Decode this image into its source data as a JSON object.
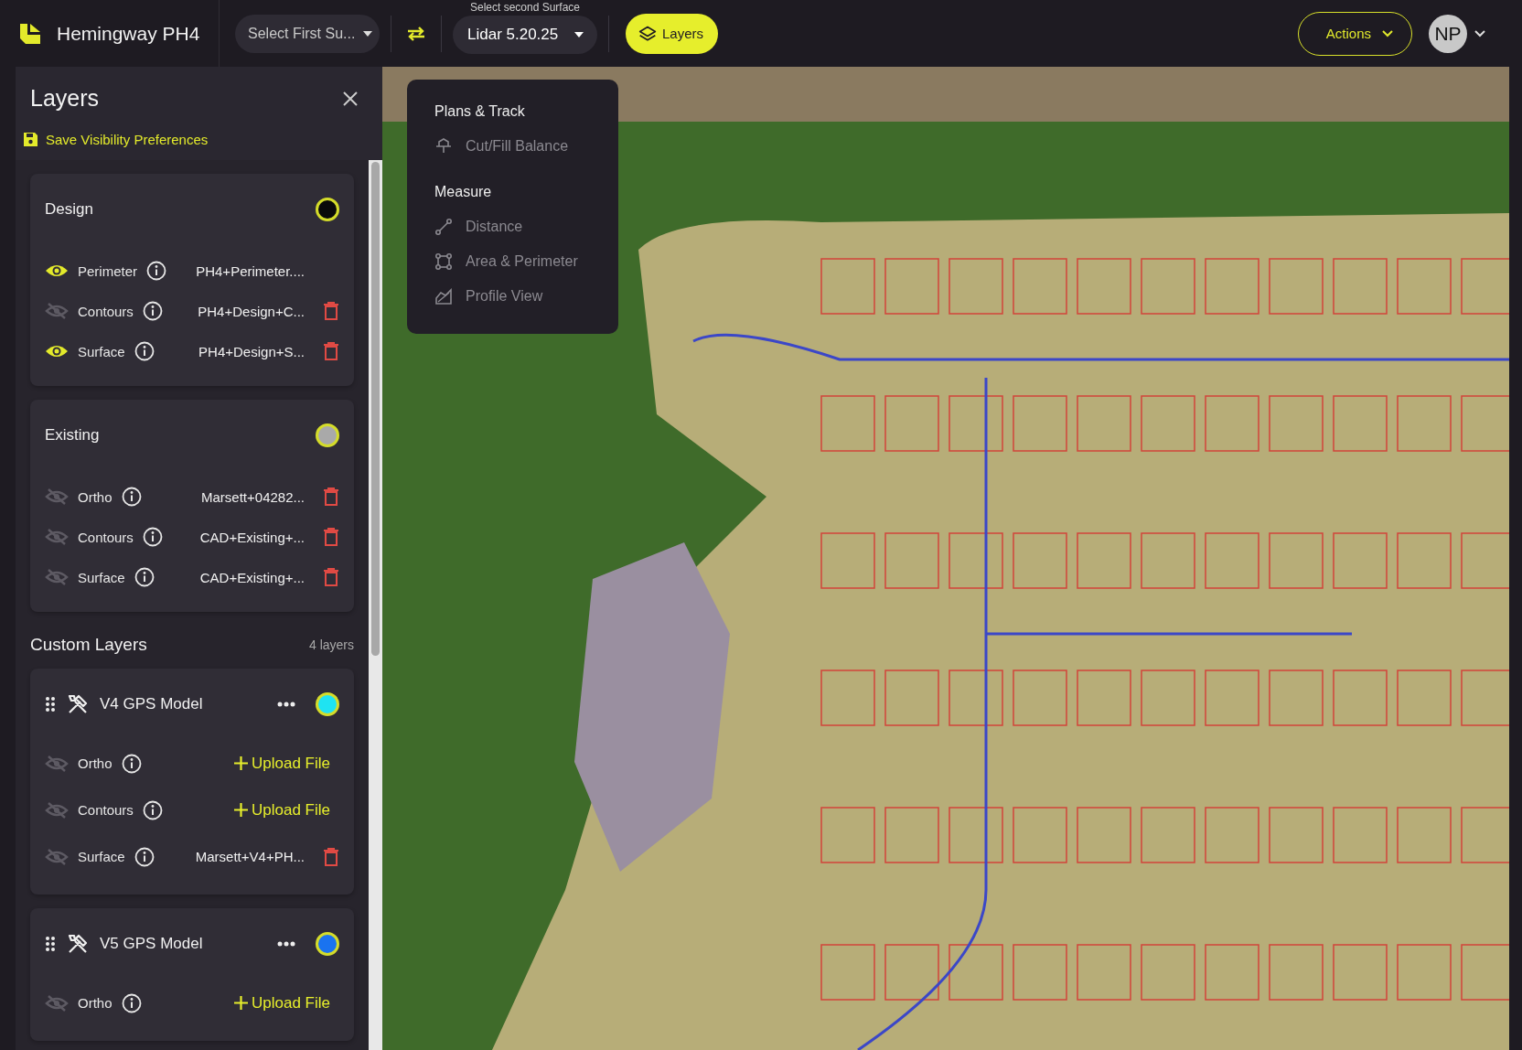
{
  "top_bar": {
    "project_title": "Hemingway PH4",
    "first_surface": {
      "placeholder": "Select First Su..."
    },
    "second_surface": {
      "label": "Select second Surface",
      "value": "Lidar 5.20.25"
    },
    "layers_button": {
      "label": "Layers",
      "selected": true
    },
    "actions_button": {
      "label": "Actions"
    },
    "avatar": {
      "initials": "NP"
    }
  },
  "layers_panel": {
    "title": "Layers",
    "save_link": "Save Visibility Preferences",
    "groups": [
      {
        "name": "Design",
        "color": "#0a0a0a",
        "rows": [
          {
            "kind": "file",
            "label": "Perimeter",
            "visible": true,
            "file": "PH4+Perimeter....",
            "deletable": false
          },
          {
            "kind": "file",
            "label": "Contours",
            "visible": false,
            "file": "PH4+Design+C...",
            "deletable": true
          },
          {
            "kind": "file",
            "label": "Surface",
            "visible": true,
            "file": "PH4+Design+S...",
            "deletable": true
          }
        ]
      },
      {
        "name": "Existing",
        "color": "#a9a9a9",
        "rows": [
          {
            "kind": "file",
            "label": "Ortho",
            "visible": false,
            "file": "Marsett+04282...",
            "deletable": true
          },
          {
            "kind": "file",
            "label": "Contours",
            "visible": false,
            "file": "CAD+Existing+...",
            "deletable": true
          },
          {
            "kind": "file",
            "label": "Surface",
            "visible": false,
            "file": "CAD+Existing+...",
            "deletable": true
          }
        ]
      }
    ],
    "custom_title": "Custom Layers",
    "custom_count": "4 layers",
    "custom_layers": [
      {
        "name": "V4 GPS Model",
        "color": "#1fe3f2",
        "rows": [
          {
            "kind": "upload",
            "label": "Ortho",
            "visible": false,
            "action": "Upload File"
          },
          {
            "kind": "upload",
            "label": "Contours",
            "visible": false,
            "action": "Upload File"
          },
          {
            "kind": "file",
            "label": "Surface",
            "visible": false,
            "file": "Marsett+V4+PH...",
            "deletable": true
          }
        ]
      },
      {
        "name": "V5 GPS Model",
        "color": "#1a73f0",
        "rows": [
          {
            "kind": "upload",
            "label": "Ortho",
            "visible": false,
            "action": "Upload File"
          }
        ]
      }
    ]
  },
  "tools_menu": {
    "sections": [
      {
        "title": "Plans & Track",
        "items": [
          {
            "kind": "cutfill",
            "label": "Cut/Fill Balance",
            "disabled": true
          }
        ]
      },
      {
        "title": "Measure",
        "items": [
          {
            "kind": "distance",
            "label": "Distance",
            "disabled": true
          },
          {
            "kind": "area",
            "label": "Area & Perimeter",
            "disabled": true
          },
          {
            "kind": "profile",
            "label": "Profile View",
            "disabled": true
          }
        ]
      }
    ]
  }
}
